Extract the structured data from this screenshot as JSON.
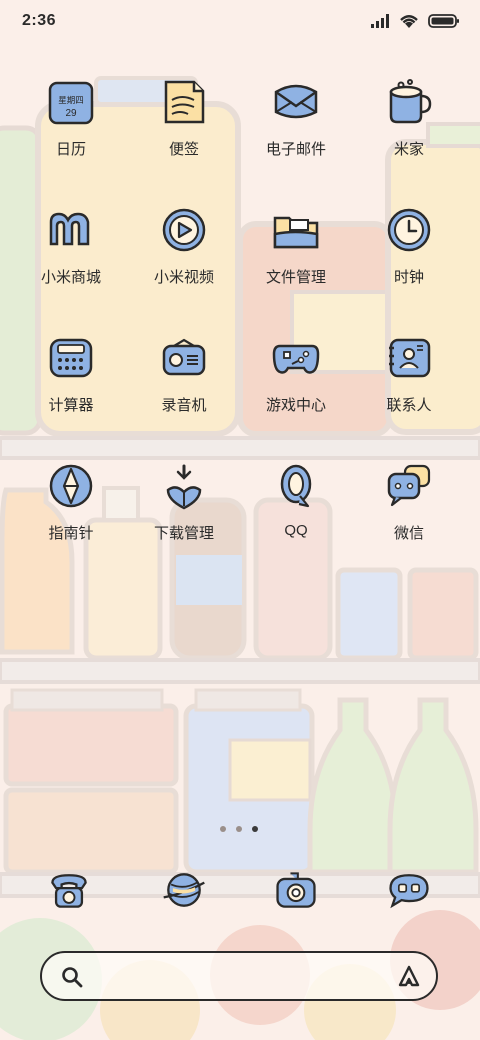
{
  "status_bar": {
    "time": "2:36",
    "icons": [
      "signal-icon",
      "wifi-icon",
      "battery-icon"
    ]
  },
  "calendar_widget": {
    "weekday": "星期四",
    "day": "29"
  },
  "apps": [
    {
      "label": "日历",
      "icon": "calendar-icon"
    },
    {
      "label": "便签",
      "icon": "notes-icon"
    },
    {
      "label": "电子邮件",
      "icon": "email-icon"
    },
    {
      "label": "米家",
      "icon": "mihome-mug-icon"
    },
    {
      "label": "小米商城",
      "icon": "mi-store-icon"
    },
    {
      "label": "小米视频",
      "icon": "video-icon"
    },
    {
      "label": "文件管理",
      "icon": "folder-icon"
    },
    {
      "label": "时钟",
      "icon": "clock-icon"
    },
    {
      "label": "计算器",
      "icon": "calculator-icon"
    },
    {
      "label": "录音机",
      "icon": "recorder-icon"
    },
    {
      "label": "游戏中心",
      "icon": "gamepad-icon"
    },
    {
      "label": "联系人",
      "icon": "contacts-icon"
    },
    {
      "label": "指南针",
      "icon": "compass-icon"
    },
    {
      "label": "下载管理",
      "icon": "download-icon"
    },
    {
      "label": "QQ",
      "icon": "qq-icon"
    },
    {
      "label": "微信",
      "icon": "wechat-icon"
    }
  ],
  "page_indicator": {
    "count": 3,
    "active": 2
  },
  "dock": [
    {
      "icon": "phone-icon"
    },
    {
      "icon": "browser-planet-icon"
    },
    {
      "icon": "camera-icon"
    },
    {
      "icon": "messages-icon"
    }
  ],
  "search_bar": {
    "left_icon": "search-icon",
    "right_icon": "assistant-icon"
  },
  "colors": {
    "accent_blue": "#8fb2e3",
    "outline": "#2a2a2a",
    "background": "#fbeee8"
  }
}
